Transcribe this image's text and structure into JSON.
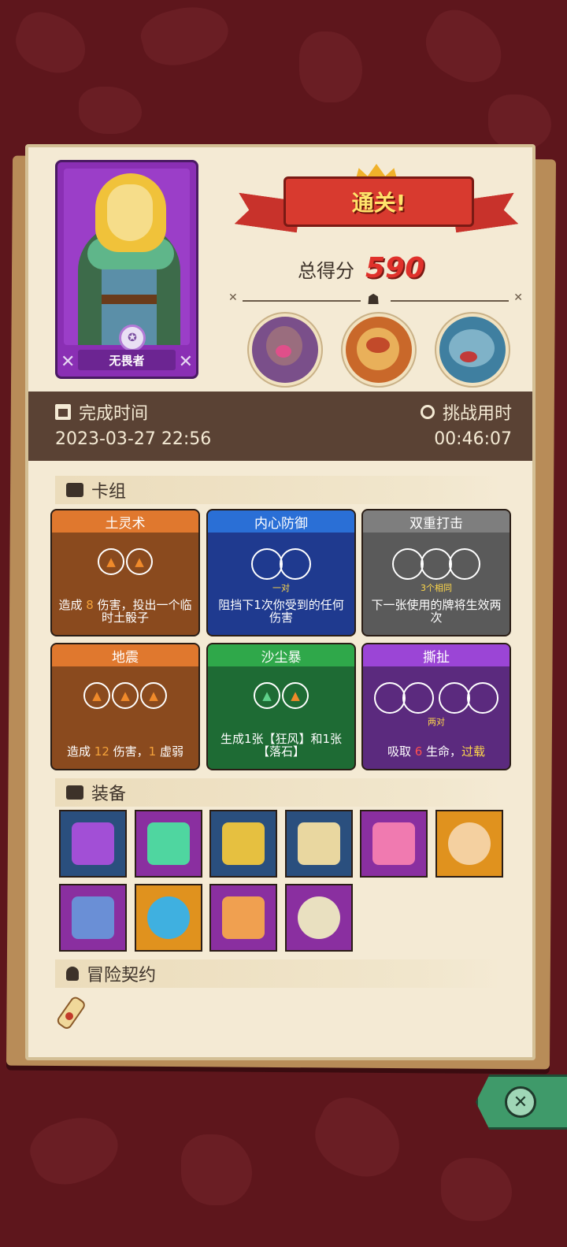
{
  "hero": {
    "title": "无畏者"
  },
  "result": {
    "banner": "通关!",
    "score_label": "总得分",
    "score_value": "590"
  },
  "time": {
    "finish_label": "完成时间",
    "finish_value": "2023-03-27 22:56",
    "challenge_label": "挑战用时",
    "challenge_value": "00:46:07"
  },
  "sections": {
    "deck": "卡组",
    "equipment": "装备",
    "contract": "冒险契约"
  },
  "cards": [
    {
      "name": "土灵术",
      "color": "#e0782e",
      "body": "#8a4a1e",
      "sub": "",
      "desc_pre": "造成 ",
      "desc_hi": "8",
      "desc_post": " 伤害，投出一个临时土骰子"
    },
    {
      "name": "内心防御",
      "color": "#2a6fd6",
      "body": "#1f3a8f",
      "sub": "一对",
      "desc_pre": "阻挡下1次你受到的任何伤害",
      "desc_hi": "",
      "desc_post": ""
    },
    {
      "name": "双重打击",
      "color": "#7e7e7e",
      "body": "#5a5a5a",
      "sub": "3个相同",
      "desc_pre": "下一张使用的牌将生效两次",
      "desc_hi": "",
      "desc_post": ""
    },
    {
      "name": "地震",
      "color": "#e0782e",
      "body": "#8a4a1e",
      "sub": "",
      "desc_pre": "造成 ",
      "desc_hi": "12",
      "desc_post": " 伤害，",
      "desc_hi2": "1",
      "desc_post2": " 虚弱"
    },
    {
      "name": "沙尘暴",
      "color": "#2fa84a",
      "body": "#1e6b34",
      "sub": "",
      "desc_pre": "生成1张【狂风】和1张【落石】",
      "desc_hi": "",
      "desc_post": ""
    },
    {
      "name": "撕扯",
      "color": "#9b45d6",
      "body": "#5b2a7e",
      "sub": "两对",
      "desc_pre": "吸取 ",
      "desc_hi": "6",
      "desc_post": " 生命，",
      "desc_hi2": "过载",
      "desc_post2": ""
    }
  ],
  "equipment": [
    {
      "name": "potion-jug-icon",
      "bg": "#2a4f7e"
    },
    {
      "name": "d20-dice-icon",
      "bg": "#8a2fa0"
    },
    {
      "name": "golden-helmet-icon",
      "bg": "#2a4f7e"
    },
    {
      "name": "scroll-map-icon",
      "bg": "#2a4f7e"
    },
    {
      "name": "heart-amulet-icon",
      "bg": "#8a2fa0"
    },
    {
      "name": "round-shield-icon",
      "bg": "#e0921e"
    },
    {
      "name": "tunic-icon",
      "bg": "#8a2fa0"
    },
    {
      "name": "magic-mirror-icon",
      "bg": "#e0921e"
    },
    {
      "name": "crown-icon",
      "bg": "#8a2fa0"
    },
    {
      "name": "hand-mirror-icon",
      "bg": "#8a2fa0"
    }
  ],
  "colors": {
    "background": "#5e161c",
    "paper": "#f4ead4",
    "band": "#5a4234",
    "score": "#e0312b"
  }
}
